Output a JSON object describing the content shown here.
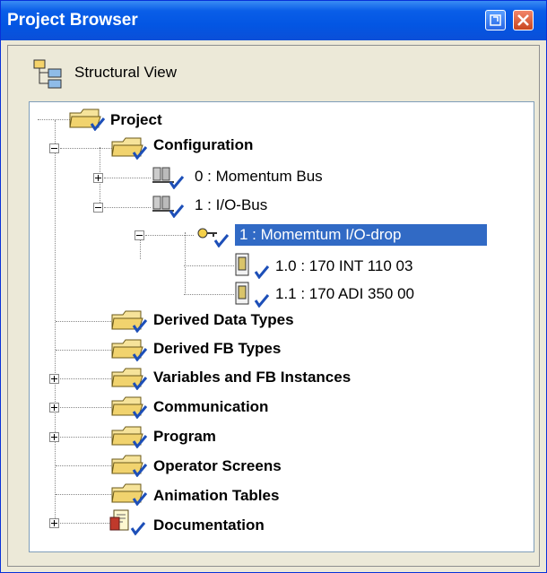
{
  "window": {
    "title": "Project Browser"
  },
  "view": {
    "label": "Structural View"
  },
  "tree": {
    "root": "Project",
    "configuration": "Configuration",
    "bus0": "0 : Momentum Bus",
    "bus1": "1 : I/O-Bus",
    "drop": "1 : Momemtum I/O-drop",
    "mod10": "1.0 : 170 INT 110 03",
    "mod11": "1.1 : 170 ADI 350 00",
    "ddt": "Derived Data Types",
    "dfb": "Derived FB Types",
    "vars": "Variables and FB Instances",
    "comm": "Communication",
    "prog": "Program",
    "ops": "Operator Screens",
    "anim": "Animation Tables",
    "doc": "Documentation"
  },
  "colors": {
    "selection": "#316ac5",
    "titlebar": "#0356e3"
  }
}
